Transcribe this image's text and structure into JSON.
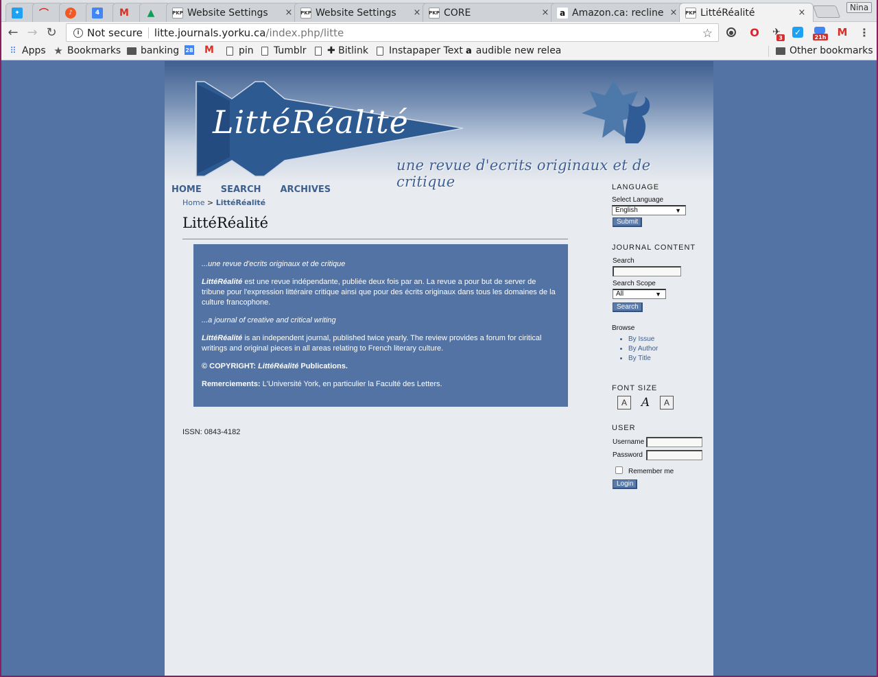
{
  "browser": {
    "tabs": [
      {
        "icon": "twitter-icon",
        "title": ""
      },
      {
        "icon": "gauge-icon",
        "title": ""
      },
      {
        "icon": "music-icon",
        "title": ""
      },
      {
        "icon": "calendar-icon",
        "title": ""
      },
      {
        "icon": "gmail-icon",
        "title": ""
      },
      {
        "icon": "drive-icon",
        "title": ""
      },
      {
        "icon": "pkp-icon",
        "title": "Website Settings"
      },
      {
        "icon": "pkp-icon",
        "title": "Website Settings"
      },
      {
        "icon": "pkp-icon",
        "title": "CORE"
      },
      {
        "icon": "amazon-icon",
        "title": "Amazon.ca: recline"
      },
      {
        "icon": "pkp-icon",
        "title": "LittéRéalité"
      }
    ],
    "pkp_label": "PKP",
    "calendar_label": "4",
    "close_glyph": "×",
    "profile_name": "Nina",
    "omnibox": {
      "security": "Not secure",
      "domain": "litte.journals.yorku.ca",
      "path": "/index.php/litte"
    },
    "extensions": {
      "badge_count": "3",
      "calendar_badge": "21h"
    },
    "bookmarks": [
      {
        "icon": "apps-icon",
        "label": "Apps"
      },
      {
        "icon": "star-icon",
        "label": "Bookmarks"
      },
      {
        "icon": "folder-icon",
        "label": "banking"
      },
      {
        "icon": "calendar-icon",
        "label": ""
      },
      {
        "icon": "gmail-icon",
        "label": ""
      },
      {
        "icon": "page-icon",
        "label": "pin"
      },
      {
        "icon": "page-icon",
        "label": "Tumblr"
      },
      {
        "icon": "page-icon",
        "label": "✚ Bitlink"
      },
      {
        "icon": "page-icon",
        "label": "Instapaper Text"
      },
      {
        "icon": "amazon-icon",
        "label": "audible new relea"
      }
    ],
    "bookmark_calendar_label": "28",
    "other_bookmarks": "Other bookmarks"
  },
  "site": {
    "logo_text": "LittéRéalité",
    "tagline": "une revue d'ecrits originaux et de critique",
    "nav": [
      "HOME",
      "SEARCH",
      "ARCHIVES"
    ],
    "breadcrumb": {
      "home": "Home",
      "separator": ">",
      "current": "LittéRéalité"
    },
    "page_title": "LittéRéalité",
    "content": {
      "intro_fr": "...une revue d'ecrits originaux et de critique",
      "name": "LittéRéalité",
      "para_fr": "est une revue indépendante, publiée deux fois par an. La revue a pour but de server de tribune pour l'expression littéraire critique ainsi que pour des écrits originaux dans tous les domaines de la culture francophone.",
      "intro_en": "...a journal of creative and critical writing",
      "para_en": "is an independent journal, published twice yearly.  The review provides a forum for ciritical writings and original pieces in all areas relating to French literary culture.",
      "copyright_prefix": "© COPYRIGHT:",
      "copyright_suffix": "Publications.",
      "thanks_label": "Remerciements:",
      "thanks_text": "L'Université York, en particulier la Faculté des Letters."
    },
    "issn": "ISSN: 0843-4182",
    "sidebar": {
      "language": {
        "heading": "LANGUAGE",
        "label": "Select Language",
        "selected": "English",
        "submit": "Submit"
      },
      "journal_content": {
        "heading": "JOURNAL CONTENT",
        "search_label": "Search",
        "scope_label": "Search Scope",
        "scope_selected": "All",
        "search_button": "Search",
        "browse_label": "Browse",
        "browse_links": [
          "By Issue",
          "By Author",
          "By Title"
        ]
      },
      "font_size": {
        "heading": "FONT SIZE"
      },
      "user": {
        "heading": "USER",
        "username_label": "Username",
        "password_label": "Password",
        "remember_label": "Remember me",
        "login_button": "Login"
      }
    }
  }
}
